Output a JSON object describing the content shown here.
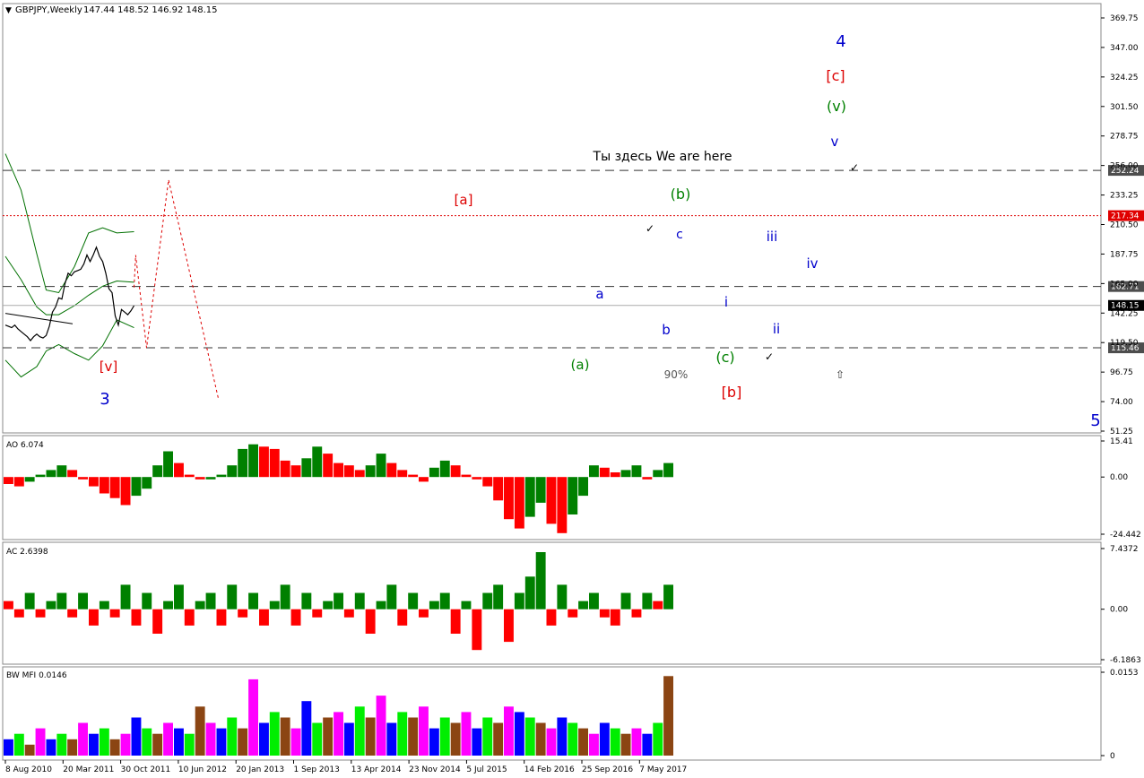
{
  "header": {
    "symbol_timeframe": "GBPJPY,Weekly",
    "ohlc": "147.44 148.52 146.92 148.15"
  },
  "colors": {
    "background": "#ffffff",
    "grid": "#c8c8c8",
    "price_line": "#000000",
    "envelope": "#007000",
    "bull_bar": "#008000",
    "bear_bar": "#ff0000",
    "forecast": "#dd0000",
    "blue_label": "#0000cc",
    "red_label": "#dd0000",
    "green_label": "#008000",
    "mfi_blue": "#0000ff",
    "mfi_green": "#00ee00",
    "mfi_brown": "#8b4513",
    "mfi_pink": "#ff00ff"
  },
  "chart_data": [
    {
      "type": "line",
      "panel": "price",
      "ylim": [
        51.25,
        369.75
      ],
      "y_ticks": [
        "369.75",
        "347.00",
        "324.25",
        "301.50",
        "278.75",
        "256.00",
        "233.25",
        "210.50",
        "187.75",
        "165.00",
        "142.25",
        "119.50",
        "96.75",
        "74.00",
        "51.25"
      ],
      "x_ticks": [
        "8 Aug 2010",
        "20 Mar 2011",
        "30 Oct 2011",
        "10 Jun 2012",
        "20 Jan 2013",
        "1 Sep 2013",
        "13 Apr 2014",
        "23 Nov 2014",
        "5 Jul 2015",
        "14 Feb 2016",
        "25 Sep 2016",
        "7 May 2017"
      ],
      "series": [
        {
          "x": [
            "2010-08",
            "2010-10",
            "2010-12",
            "2011-02",
            "2011-04",
            "2011-06",
            "2011-08",
            "2011-10",
            "2011-12",
            "2012-02",
            "2012-04",
            "2012-06",
            "2012-08",
            "2012-10",
            "2012-12",
            "2013-02",
            "2013-04",
            "2013-06",
            "2013-08",
            "2013-10",
            "2013-12",
            "2014-02",
            "2014-04",
            "2014-06",
            "2014-08",
            "2014-10",
            "2014-12",
            "2015-02",
            "2015-04",
            "2015-06",
            "2015-08",
            "2015-10",
            "2015-12",
            "2016-02",
            "2016-04",
            "2016-06",
            "2016-08",
            "2016-10",
            "2016-12",
            "2017-02",
            "2017-04",
            "2017-06"
          ],
          "y": [
            133,
            132,
            131,
            133,
            130,
            128,
            126,
            124,
            121,
            124,
            126,
            124,
            123,
            125,
            132,
            143,
            147,
            154,
            153,
            165,
            173,
            171,
            174,
            175,
            176,
            180,
            187,
            182,
            187,
            193,
            186,
            182,
            173,
            161,
            158,
            140,
            133,
            145,
            143,
            141,
            144,
            148
          ]
        }
      ],
      "envelope_lines": [
        {
          "name": "",
          "x": [
            "2010-08",
            "2011-06",
            "2012-04",
            "2012-10",
            "2013-06",
            "2014-04",
            "2015-01",
            "2015-10",
            "2016-07",
            "2017-06"
          ],
          "y": [
            265,
            237,
            188,
            160,
            158,
            178,
            204,
            208,
            204,
            205
          ]
        },
        {
          "name": "",
          "x": [
            "2010-08",
            "2011-06",
            "2012-04",
            "2012-10",
            "2013-06",
            "2014-04",
            "2015-01",
            "2015-10",
            "2016-07",
            "2017-06"
          ],
          "y": [
            186,
            168,
            147,
            141,
            141,
            148,
            156,
            163,
            167,
            166
          ]
        },
        {
          "name": "",
          "x": [
            "2010-08",
            "2011-06",
            "2012-04",
            "2012-10",
            "2013-06",
            "2014-04",
            "2015-01",
            "2015-10",
            "2016-07",
            "2017-06"
          ],
          "y": [
            106,
            93,
            101,
            113,
            118,
            111,
            106,
            117,
            137,
            131
          ]
        }
      ],
      "forecast_path": {
        "x": [
          "2017-06",
          "2017-07",
          "2018-02",
          "2019-04",
          "2021-12"
        ],
        "y": [
          162,
          187,
          115.46,
          245,
          75
        ]
      },
      "horizontal_levels": [
        {
          "label": "252.24",
          "value": 252.24,
          "style": "dashed"
        },
        {
          "label": "217.34",
          "value": 217.34,
          "style": "dotted-red"
        },
        {
          "label": "162.71",
          "value": 162.71,
          "style": "dashed"
        },
        {
          "label": "148.15",
          "value": 148.15,
          "style": "current"
        },
        {
          "label": "115.46",
          "value": 115.46,
          "style": "dashed"
        }
      ],
      "wave_labels": [
        {
          "text": "4",
          "color": "blue"
        },
        {
          "text": "[c]",
          "color": "red"
        },
        {
          "text": "(v)",
          "color": "green"
        },
        {
          "text": "v",
          "color": "blue"
        },
        {
          "text": "Ты здесь We are here",
          "color": "black"
        },
        {
          "text": "(b)",
          "color": "green"
        },
        {
          "text": "[a]",
          "color": "red"
        },
        {
          "text": "c",
          "color": "blue"
        },
        {
          "text": "iii",
          "color": "blue"
        },
        {
          "text": "iv",
          "color": "blue"
        },
        {
          "text": "a",
          "color": "blue"
        },
        {
          "text": "i",
          "color": "blue"
        },
        {
          "text": "ii",
          "color": "blue"
        },
        {
          "text": "b",
          "color": "blue"
        },
        {
          "text": "(a)",
          "color": "green"
        },
        {
          "text": "(c)",
          "color": "green"
        },
        {
          "text": "[v]",
          "color": "red"
        },
        {
          "text": "3",
          "color": "blue"
        },
        {
          "text": "90%",
          "color": "gray"
        },
        {
          "text": "[b]",
          "color": "red"
        },
        {
          "text": "5",
          "color": "blue"
        }
      ]
    },
    {
      "type": "bar",
      "panel": "AO",
      "title": "AO 6.074",
      "ylim": [
        -24.442,
        15.41
      ],
      "y_ticks": [
        "15.41",
        "0.00",
        "-24.442"
      ],
      "values": [
        -3,
        -4,
        -2,
        1,
        3,
        5,
        3,
        -1,
        -4,
        -7,
        -9,
        -12,
        -8,
        -5,
        5,
        11,
        6,
        1,
        -1,
        -1,
        1,
        5,
        12,
        14,
        13,
        12,
        7,
        5,
        8,
        13,
        10,
        6,
        5,
        3,
        5,
        10,
        6,
        3,
        1,
        -2,
        4,
        7,
        5,
        1,
        -1,
        -4,
        -10,
        -18,
        -22,
        -17,
        -11,
        -20,
        -24,
        -16,
        -8,
        5,
        4,
        2,
        3,
        5,
        -1,
        3,
        6
      ]
    },
    {
      "type": "bar",
      "panel": "AC",
      "title": "AC 2.6398",
      "ylim": [
        -6.1863,
        7.4372
      ],
      "y_ticks": [
        "7.4372",
        "0.00",
        "-6.1863"
      ],
      "values": [
        1,
        -1,
        2,
        -1,
        1,
        2,
        -1,
        2,
        -2,
        1,
        -1,
        3,
        -2,
        2,
        -3,
        1,
        3,
        -2,
        1,
        2,
        -2,
        3,
        -1,
        2,
        -2,
        1,
        3,
        -2,
        2,
        -1,
        1,
        2,
        -1,
        2,
        -3,
        1,
        3,
        -2,
        2,
        -1,
        1,
        2,
        -3,
        1,
        -5,
        2,
        3,
        -4,
        2,
        4,
        7,
        -2,
        3,
        -1,
        1,
        2,
        -1,
        -2,
        2,
        -1,
        2,
        1,
        3
      ]
    },
    {
      "type": "bar",
      "panel": "BW MFI",
      "title": "BW MFI 0.0146",
      "ylim": [
        0,
        0.0153
      ],
      "y_ticks": [
        "0.0153",
        "0"
      ],
      "values": [
        0.003,
        0.004,
        0.002,
        0.005,
        0.003,
        0.004,
        0.003,
        0.006,
        0.004,
        0.005,
        0.003,
        0.004,
        0.007,
        0.005,
        0.004,
        0.006,
        0.005,
        0.004,
        0.009,
        0.006,
        0.005,
        0.007,
        0.005,
        0.014,
        0.006,
        0.008,
        0.007,
        0.005,
        0.01,
        0.006,
        0.007,
        0.008,
        0.006,
        0.009,
        0.007,
        0.011,
        0.006,
        0.008,
        0.007,
        0.009,
        0.005,
        0.007,
        0.006,
        0.008,
        0.005,
        0.007,
        0.006,
        0.009,
        0.008,
        0.007,
        0.006,
        0.005,
        0.007,
        0.006,
        0.005,
        0.004,
        0.006,
        0.005,
        0.004,
        0.005,
        0.004,
        0.006,
        0.0146
      ]
    }
  ]
}
